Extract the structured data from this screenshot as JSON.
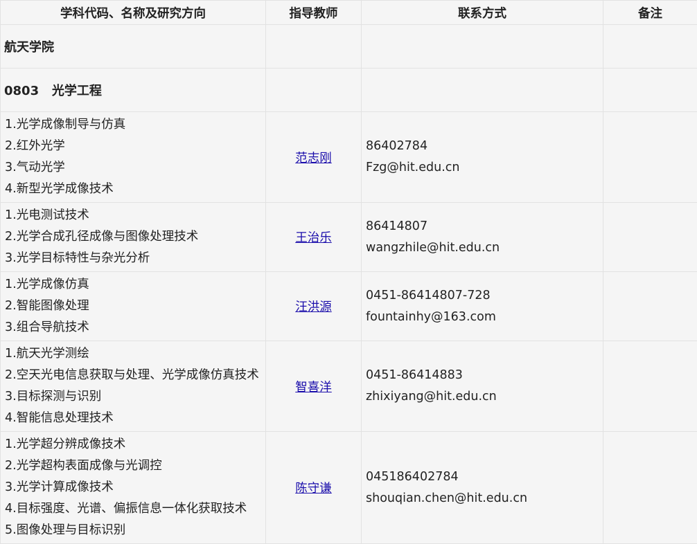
{
  "headers": [
    "学科代码、名称及研究方向",
    "指导教师",
    "联系方式",
    "备注"
  ],
  "school": "航天学院",
  "discipline": "0803   光学工程",
  "rows": [
    {
      "directions": [
        "1.光学成像制导与仿真",
        "2.红外光学",
        "3.气动光学",
        "4.新型光学成像技术"
      ],
      "advisor": "范志刚",
      "phone": "86402784",
      "email": "Fzg@hit.edu.cn",
      "note": ""
    },
    {
      "directions": [
        "1.光电测试技术",
        "2.光学合成孔径成像与图像处理技术",
        "3.光学目标特性与杂光分析"
      ],
      "advisor": "王治乐",
      "phone": "86414807",
      "email": "wangzhile@hit.edu.cn",
      "note": ""
    },
    {
      "directions": [
        "1.光学成像仿真",
        "2.智能图像处理",
        "3.组合导航技术"
      ],
      "advisor": "汪洪源",
      "phone": "0451-86414807-728",
      "email": "fountainhy@163.com",
      "note": ""
    },
    {
      "directions": [
        "1.航天光学测绘",
        "2.空天光电信息获取与处理、光学成像仿真技术",
        "3.目标探测与识别",
        "4.智能信息处理技术"
      ],
      "advisor": "智喜洋",
      "phone": "0451-86414883",
      "email": "zhixiyang@hit.edu.cn",
      "note": ""
    },
    {
      "directions": [
        "1.光学超分辨成像技术",
        "2.光学超构表面成像与光调控",
        "3.光学计算成像技术",
        "4.目标强度、光谱、偏振信息一体化获取技术",
        "5.图像处理与目标识别"
      ],
      "advisor": "陈守谦",
      "phone": "045186402784",
      "email": "shouqian.chen@hit.edu.cn",
      "note": ""
    }
  ]
}
